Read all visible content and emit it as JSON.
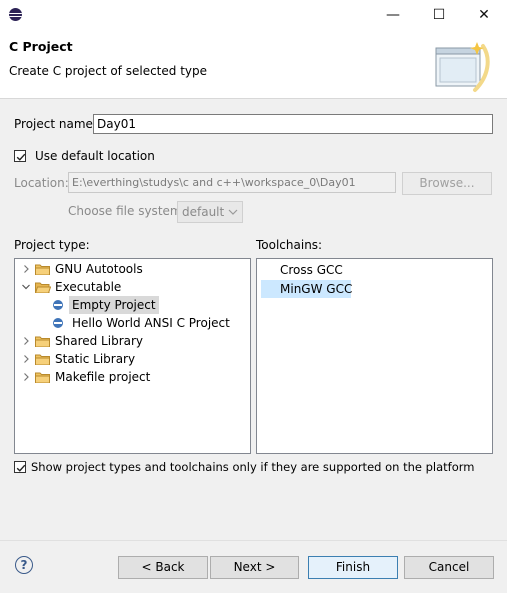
{
  "window": {
    "minimize_glyph": "—",
    "maximize_glyph": "☐",
    "close_glyph": "✕"
  },
  "header": {
    "title": "C Project",
    "subtitle": "Create C project of selected type"
  },
  "form": {
    "project_name_label": "Project name:",
    "project_name_value": "Day01",
    "use_default_location_label": "Use default location",
    "use_default_location_checked": true,
    "location_label": "Location:",
    "location_value": "E:\\everthing\\studys\\c and c++\\workspace_0\\Day01",
    "browse_label": "Browse...",
    "file_system_label": "Choose file system:",
    "file_system_value": "default"
  },
  "project_type": {
    "label": "Project type:",
    "items": [
      {
        "label": "GNU Autotools",
        "kind": "folder",
        "expanded": false,
        "level": 0
      },
      {
        "label": "Executable",
        "kind": "folder",
        "expanded": true,
        "level": 0
      },
      {
        "label": "Empty Project",
        "kind": "project",
        "level": 1,
        "selected": true
      },
      {
        "label": "Hello World ANSI C Project",
        "kind": "project",
        "level": 1
      },
      {
        "label": "Shared Library",
        "kind": "folder",
        "expanded": false,
        "level": 0
      },
      {
        "label": "Static Library",
        "kind": "folder",
        "expanded": false,
        "level": 0
      },
      {
        "label": "Makefile project",
        "kind": "folder",
        "expanded": false,
        "level": 0
      }
    ]
  },
  "toolchains": {
    "label": "Toolchains:",
    "items": [
      {
        "label": "Cross GCC",
        "selected": false
      },
      {
        "label": "MinGW GCC",
        "selected": true
      }
    ]
  },
  "filter": {
    "label": "Show project types and toolchains only if they are supported on the platform",
    "checked": true
  },
  "buttons": {
    "help": "?",
    "back": "< Back",
    "next": "Next >",
    "finish": "Finish",
    "cancel": "Cancel"
  },
  "icons": {
    "app": "eclipse-icon",
    "folder": "folder-icon",
    "project": "c-project-icon",
    "help": "help-icon",
    "wizard": "new-project-wizard-icon"
  }
}
